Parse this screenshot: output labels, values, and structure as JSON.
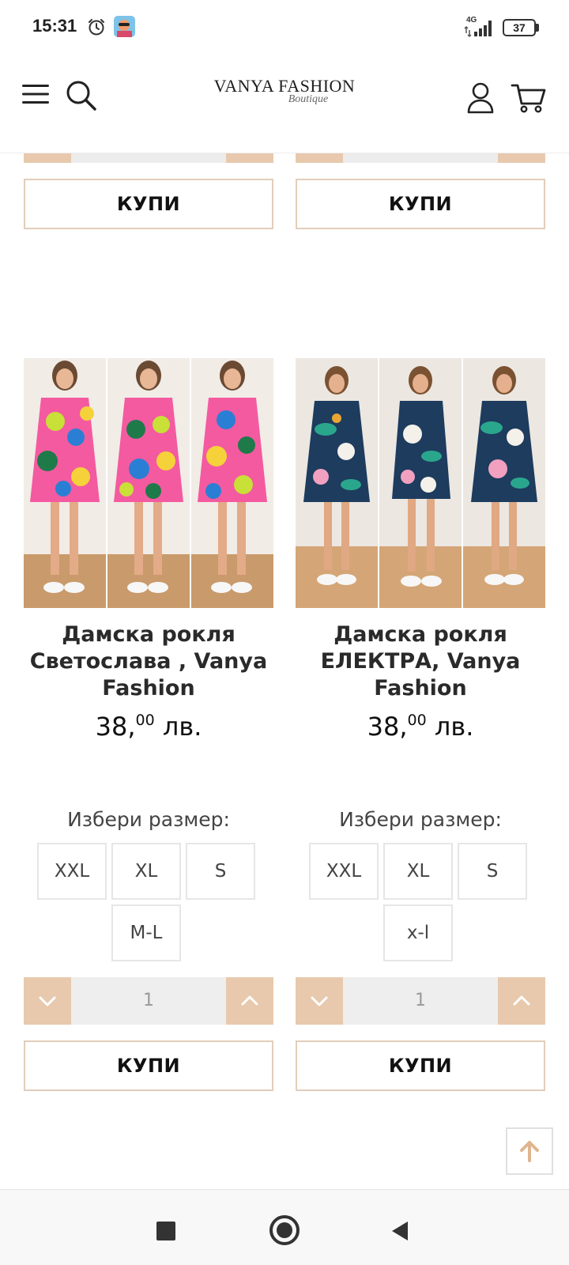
{
  "status_bar": {
    "time": "15:31",
    "network": "4G",
    "battery": "37"
  },
  "header": {
    "logo_main": "VANYA FASHION",
    "logo_sub": "Boutique"
  },
  "previous_cards": {
    "buy_label_left": "КУПИ",
    "buy_label_right": "КУПИ"
  },
  "products": [
    {
      "title": "Дамска рокля Светослава , Vanya Fashion",
      "price_main": "38,",
      "price_cents": "00",
      "currency": " лв.",
      "size_prompt": "Избери размер:",
      "sizes": [
        "XXL",
        "XL",
        "S",
        "M-L"
      ],
      "quantity": "1",
      "buy_label": "КУПИ",
      "image_palette": [
        "#f45aa0",
        "#c8e038",
        "#2a7fd4",
        "#1f7a4a",
        "#f5d23a"
      ]
    },
    {
      "title": "Дамска рокля ЕЛЕКТРА, Vanya Fashion",
      "price_main": "38,",
      "price_cents": "00",
      "currency": " лв.",
      "size_prompt": "Избери размер:",
      "sizes": [
        "XXL",
        "XL",
        "S",
        "x-l"
      ],
      "quantity": "1",
      "buy_label": "КУПИ",
      "image_palette": [
        "#1d3c5e",
        "#2aa68c",
        "#f4f1ea",
        "#f2a0c0",
        "#e9a531"
      ]
    }
  ],
  "colors": {
    "accent": "#e8c9ad",
    "button_border": "#e2cdbb",
    "qty_field": "#eeeeee"
  },
  "icons": {
    "menu": "menu-icon",
    "search": "search-icon",
    "account": "user-icon",
    "cart": "cart-icon",
    "scroll_top": "arrow-up-icon"
  }
}
